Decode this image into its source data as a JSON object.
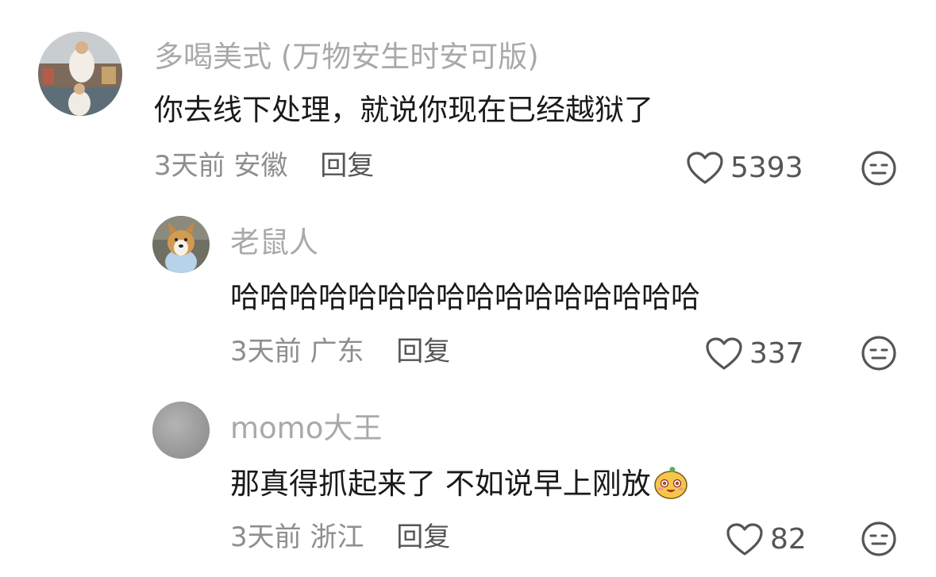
{
  "comments": [
    {
      "username": "多喝美式 (万物安生时安可版)",
      "content": "你去线下处理，就说你现在已经越狱了",
      "time": "3天前",
      "location": "安徽",
      "reply_label": "回复",
      "likes": "5393",
      "avatar_icon": "photo-avatar"
    },
    {
      "username": "老鼠人",
      "content": "哈哈哈哈哈哈哈哈哈哈哈哈哈哈哈哈",
      "time": "3天前",
      "location": "广东",
      "reply_label": "回复",
      "likes": "337",
      "avatar_icon": "corgi-avatar"
    },
    {
      "username": "momo大王",
      "content": "那真得抓起来了 不如说早上刚放",
      "time": "3天前",
      "location": "浙江",
      "reply_label": "回复",
      "likes": "82",
      "avatar_icon": "gray-default-avatar",
      "inline_emoji": "smiling-fruit-emoji"
    }
  ],
  "icons": {
    "like": "heart-outline-icon",
    "dislike": "neutral-face-icon"
  },
  "colors": {
    "username": "#a9a9a9",
    "content": "#1a1a1a",
    "meta": "#8e8e8e",
    "icon_stroke": "#555555"
  }
}
